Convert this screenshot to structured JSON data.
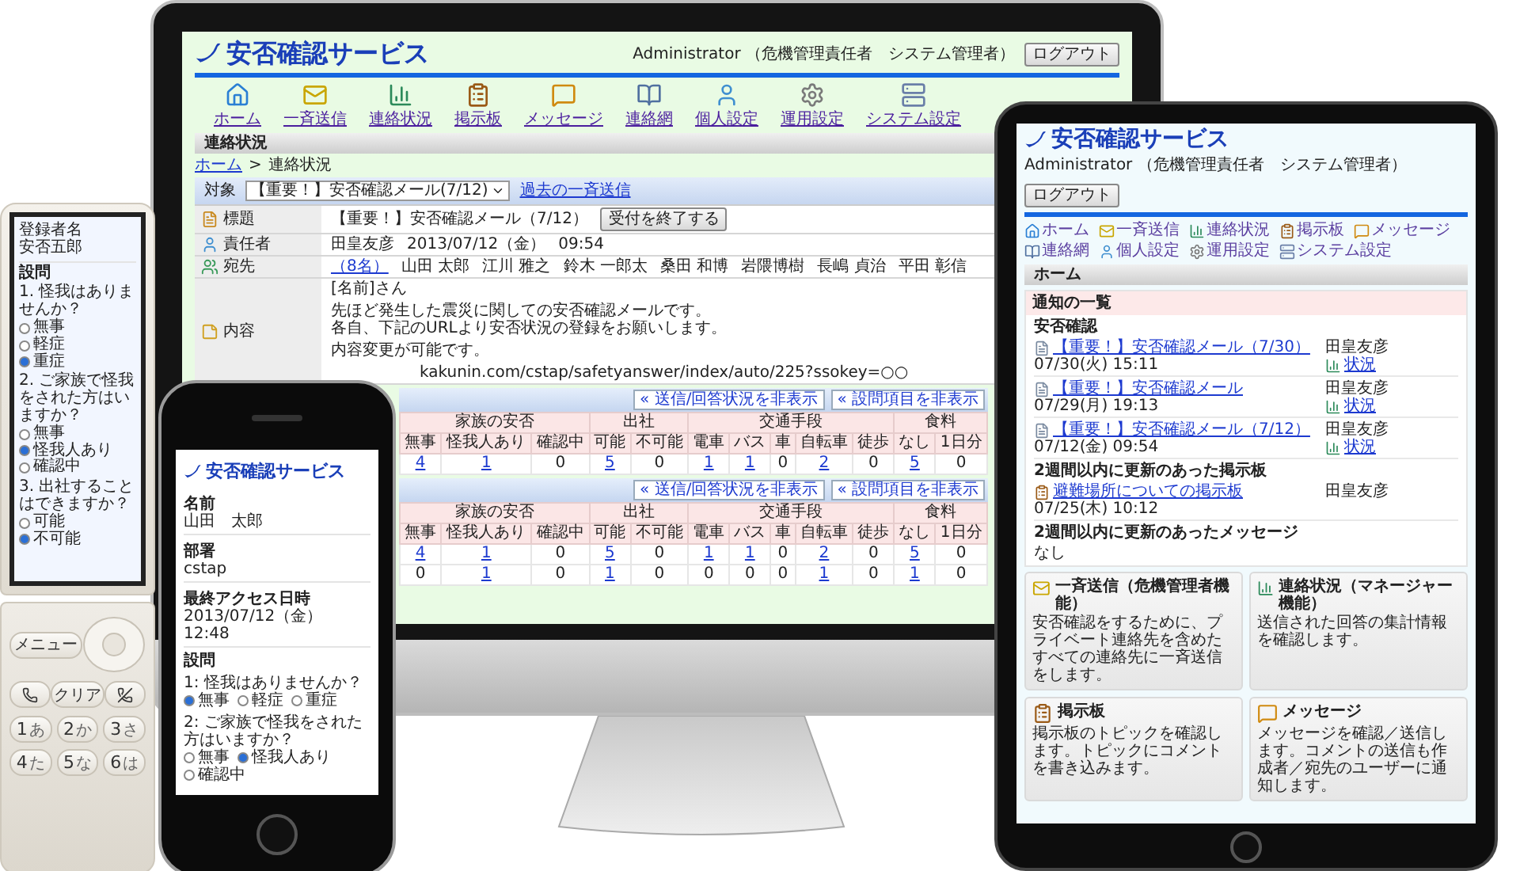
{
  "monitor": {
    "logo": "安否確認サービス",
    "user": "Administrator （危機管理責任者　システム管理者）",
    "logout": "ログアウト",
    "nav": [
      "ホーム",
      "一斉送信",
      "連絡状況",
      "掲示板",
      "メッセージ",
      "連絡網",
      "個人設定",
      "運用設定",
      "システム設定"
    ],
    "section": "連絡状況",
    "breadcrumb": {
      "link": "ホーム",
      "separator": ">",
      "current": "連絡状況"
    },
    "target": {
      "label": "対象",
      "value": "【重要！】安否確認メール(7/12)",
      "link": "過去の一斉送信"
    },
    "details": [
      {
        "kind": "title",
        "label": "標題",
        "value": "【重要！】安否確認メール（7/12）",
        "button": "受付を終了する"
      },
      {
        "kind": "owner",
        "label": "責任者",
        "values": [
          "田皇友彦",
          "2013/07/12（金）",
          "09:54"
        ]
      },
      {
        "kind": "recipients",
        "label": "宛先",
        "count": "（8名）",
        "names": [
          "山田 太郎",
          "江川 雅之",
          "鈴木 一郎太",
          "桑田 和博",
          "岩隈博樹",
          "長嶋 貞治",
          "平田 彰信"
        ]
      },
      {
        "kind": "body",
        "label": "内容",
        "paragraphs": [
          [
            "[名前]さん"
          ],
          [
            "先ほど発生した震災に関しての安否確認メールです。",
            "各自、下記のURLより安否状況の登録をお願いします。"
          ],
          [
            "内容変更が可能です。"
          ]
        ],
        "url": "kakunin.com/cstap/safetyanswer/index/auto/225?ssokey=○○"
      }
    ],
    "tables": [
      {
        "buttons": [
          "« 送信/回答状況を非表示",
          "« 設問項目を非表示"
        ],
        "groups": [
          {
            "label": "家族の安否",
            "columns": [
              "無事",
              "怪我人あり",
              "確認中"
            ]
          },
          {
            "label": "出社",
            "columns": [
              "可能",
              "不可能"
            ]
          },
          {
            "label": "交通手段",
            "columns": [
              "電車",
              "バス",
              "車",
              "自転車",
              "徒歩"
            ]
          },
          {
            "label": "食料",
            "columns": [
              "なし",
              "1日分"
            ]
          }
        ],
        "rows": [
          [
            {
              "value": "4",
              "link": true
            },
            {
              "value": "1",
              "link": true
            },
            {
              "value": "0",
              "link": false
            },
            {
              "value": "5",
              "link": true
            },
            {
              "value": "0",
              "link": false
            },
            {
              "value": "1",
              "link": true
            },
            {
              "value": "1",
              "link": true
            },
            {
              "value": "0",
              "link": false
            },
            {
              "value": "2",
              "link": true
            },
            {
              "value": "0",
              "link": false
            },
            {
              "value": "5",
              "link": true
            },
            {
              "value": "0",
              "link": false
            }
          ]
        ]
      },
      {
        "buttons": [
          "« 送信/回答状況を非表示",
          "« 設問項目を非表示"
        ],
        "groups": [
          {
            "label": "家族の安否",
            "columns": [
              "無事",
              "怪我人あり",
              "確認中"
            ]
          },
          {
            "label": "出社",
            "columns": [
              "可能",
              "不可能"
            ]
          },
          {
            "label": "交通手段",
            "columns": [
              "電車",
              "バス",
              "車",
              "自転車",
              "徒歩"
            ]
          },
          {
            "label": "食料",
            "columns": [
              "なし",
              "1日分"
            ]
          }
        ],
        "rows": [
          [
            {
              "value": "4",
              "link": true
            },
            {
              "value": "1",
              "link": true
            },
            {
              "value": "0",
              "link": false
            },
            {
              "value": "5",
              "link": true
            },
            {
              "value": "0",
              "link": false
            },
            {
              "value": "1",
              "link": true
            },
            {
              "value": "1",
              "link": true
            },
            {
              "value": "0",
              "link": false
            },
            {
              "value": "2",
              "link": true
            },
            {
              "value": "0",
              "link": false
            },
            {
              "value": "5",
              "link": true
            },
            {
              "value": "0",
              "link": false
            }
          ],
          [
            {
              "value": "0",
              "link": false
            },
            {
              "value": "1",
              "link": true
            },
            {
              "value": "0",
              "link": false
            },
            {
              "value": "1",
              "link": true
            },
            {
              "value": "0",
              "link": false
            },
            {
              "value": "0",
              "link": false
            },
            {
              "value": "0",
              "link": false
            },
            {
              "value": "0",
              "link": false
            },
            {
              "value": "1",
              "link": true
            },
            {
              "value": "0",
              "link": false
            },
            {
              "value": "1",
              "link": true
            },
            {
              "value": "0",
              "link": false
            }
          ]
        ]
      }
    ]
  },
  "tablet": {
    "logo": "安否確認サービス",
    "user": "Administrator （危機管理責任者　システム管理者）",
    "logout": "ログアウト",
    "nav": [
      "ホーム",
      "一斉送信",
      "連絡状況",
      "掲示板",
      "メッセージ",
      "連絡網",
      "個人設定",
      "運用設定",
      "システム設定"
    ],
    "section": "ホーム",
    "panel_title": "通知の一覧",
    "groups": [
      {
        "title": "安否確認",
        "items": [
          {
            "title": "【重要！】安否確認メール（7/30）",
            "author": "田皇友彦",
            "date": "07/30(火) 15:11",
            "status": "状況"
          },
          {
            "title": "【重要！】安否確認メール",
            "author": "田皇友彦",
            "date": "07/29(月) 19:13",
            "status": "状況"
          },
          {
            "title": "【重要！】安否確認メール（7/12）",
            "author": "田皇友彦",
            "date": "07/12(金) 09:54",
            "status": "状況"
          }
        ]
      },
      {
        "title": "2週間以内に更新のあった掲示板",
        "items": [
          {
            "title": "避難場所についての掲示板",
            "author": "田皇友彦",
            "date": "07/25(木) 10:12"
          }
        ]
      },
      {
        "title": "2週間以内に更新のあったメッセージ",
        "empty": "なし"
      }
    ],
    "cards": [
      {
        "title": "一斉送信（危機管理者機能）",
        "text": "安否確認をするために、プライベート連絡先を含めたすべての連絡先に一斉送信をします。"
      },
      {
        "title": "連絡状況（マネージャー機能）",
        "text": "送信された回答の集計情報を確認します。"
      },
      {
        "title": "掲示板",
        "text": "掲示板のトピックを確認します。トピックにコメントを書き込みます。"
      },
      {
        "title": "メッセージ",
        "text": "メッセージを確認／送信します。コメントの送信も作成者／宛先のユーザーに通知します。"
      }
    ]
  },
  "iphone": {
    "logo": "安否確認サービス",
    "fields": [
      {
        "label": "名前",
        "value": "山田　太郎"
      },
      {
        "label": "部署",
        "value": "cstap"
      },
      {
        "label": "最終アクセス日時",
        "value": "2013/07/12（金） 12:48"
      }
    ],
    "survey_title": "設問",
    "questions": [
      {
        "text": "1: 怪我はありませんか？",
        "options": [
          {
            "label": "無事",
            "selected": true
          },
          {
            "label": "軽症",
            "selected": false
          },
          {
            "label": "重症",
            "selected": false
          }
        ]
      },
      {
        "text": "2: ご家族で怪我をされた方はいますか？",
        "options": [
          {
            "label": "無事",
            "selected": false
          },
          {
            "label": "怪我人あり",
            "selected": true
          },
          {
            "label": "確認中",
            "selected": false
          }
        ]
      }
    ]
  },
  "flip_phone": {
    "fields": [
      {
        "label": "登録者名",
        "value": "安否五郎"
      }
    ],
    "survey_title": "設問",
    "questions": [
      {
        "text": "1. 怪我はありませんか？",
        "options": [
          {
            "label": "無事",
            "selected": false
          },
          {
            "label": "軽症",
            "selected": false
          },
          {
            "label": "重症",
            "selected": true
          }
        ]
      },
      {
        "text": "2. ご家族で怪我をされた方はいますか？",
        "options": [
          {
            "label": "無事",
            "selected": false
          },
          {
            "label": "怪我人あり",
            "selected": true
          },
          {
            "label": "確認中",
            "selected": false
          }
        ]
      },
      {
        "text": "3. 出社することはできますか？",
        "options": [
          {
            "label": "可能",
            "selected": false
          },
          {
            "label": "不可能",
            "selected": true
          }
        ]
      }
    ],
    "menu_key": "メニュー",
    "clear_key": "クリア",
    "keys": [
      {
        "digit": "1",
        "kana": "あ"
      },
      {
        "digit": "2",
        "kana": "か"
      },
      {
        "digit": "3",
        "kana": "さ"
      },
      {
        "digit": "4",
        "kana": "た"
      },
      {
        "digit": "5",
        "kana": "な"
      },
      {
        "digit": "6",
        "kana": "は"
      }
    ]
  }
}
